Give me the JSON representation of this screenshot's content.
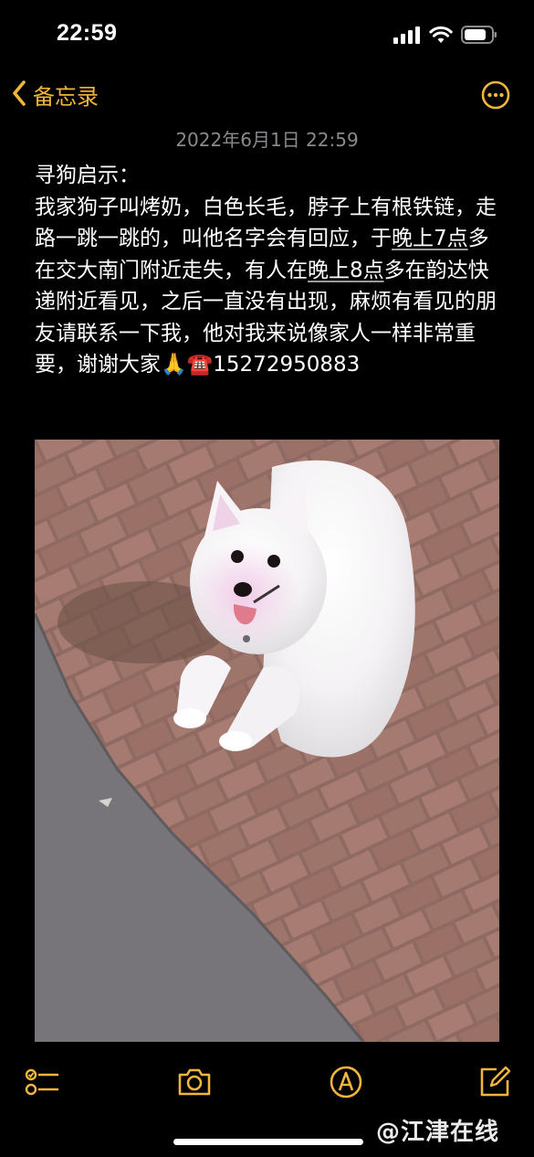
{
  "status_bar": {
    "time": "22:59"
  },
  "nav": {
    "back_label": "备忘录",
    "back_icon": "chevron-left-icon",
    "more_icon": "ellipsis-circle-icon",
    "accent_color": "#f1b53a"
  },
  "note": {
    "date": "2022年6月1日 22:59",
    "title": "寻狗启示：",
    "body_parts": {
      "p1": "我家狗子叫烤奶，白色长毛，脖子上有根铁链，走路一跳一跳的，叫他名字会有回应，于",
      "time1": "晚上7点",
      "p2": "多在交大南门附近走失，有人在",
      "time2": "晚上8点",
      "p3": "多在韵达快递附近看见，之后一直没有出现，麻烦有看见的朋友请联系一下我，他对我来说像家人一样非常重要，谢谢大家",
      "emoji_pray": "🙏",
      "emoji_phone": "☎️",
      "phone": "15272950883"
    }
  },
  "toolbar": {
    "items": [
      "checklist-icon",
      "camera-icon",
      "markup-pen-icon",
      "compose-icon"
    ]
  },
  "watermark": "@江津在线"
}
